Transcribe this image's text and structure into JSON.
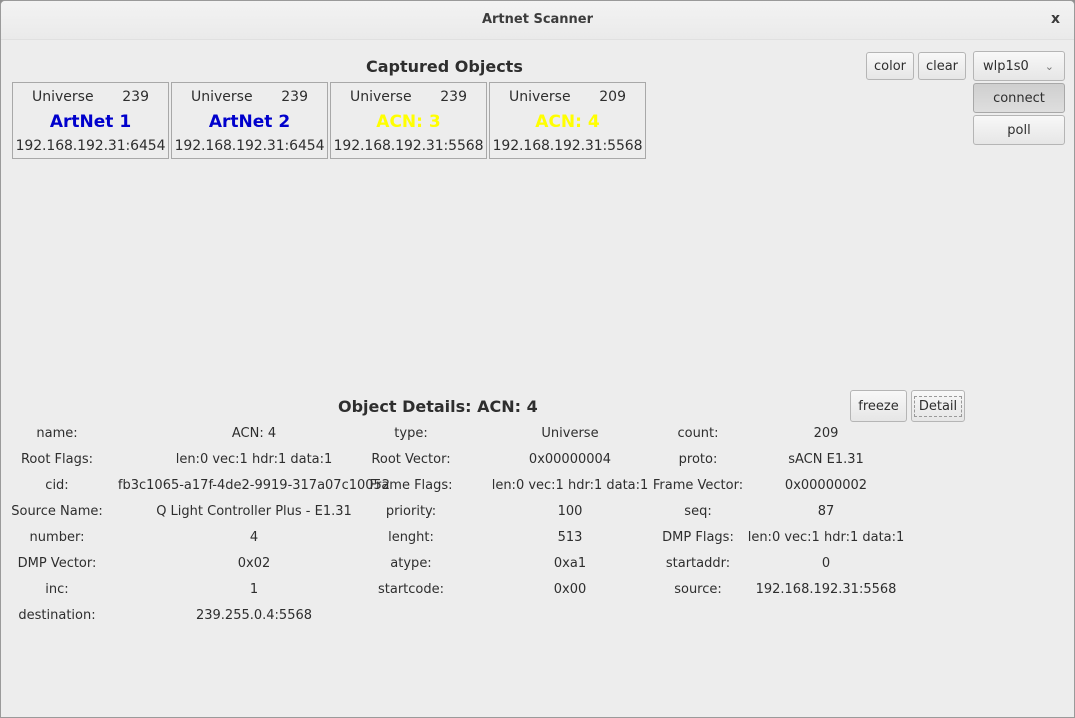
{
  "window": {
    "title": "Artnet Scanner",
    "close_glyph": "x"
  },
  "captured": {
    "title": "Captured Objects",
    "cards": [
      {
        "type": "Universe",
        "count": "239",
        "name": "ArtNet 1",
        "address": "192.168.192.31:6454",
        "name_color": "#0000cc"
      },
      {
        "type": "Universe",
        "count": "239",
        "name": "ArtNet 2",
        "address": "192.168.192.31:6454",
        "name_color": "#0000cc"
      },
      {
        "type": "Universe",
        "count": "239",
        "name": "ACN: 3",
        "address": "192.168.192.31:5568",
        "name_color": "#ffff00"
      },
      {
        "type": "Universe",
        "count": "209",
        "name": "ACN: 4",
        "address": "192.168.192.31:5568",
        "name_color": "#ffff00"
      }
    ]
  },
  "toolbar": {
    "color_label": "color",
    "clear_label": "clear",
    "interface_selected": "wlp1s0",
    "connect_label": "connect",
    "poll_label": "poll"
  },
  "details": {
    "title": "Object Details: ACN: 4",
    "freeze_label": "freeze",
    "detail_label": "Detail",
    "rows": [
      [
        [
          "name:",
          "ACN: 4"
        ],
        [
          "type:",
          "Universe"
        ],
        [
          "count:",
          "209"
        ]
      ],
      [
        [
          "Root Flags:",
          "len:0 vec:1 hdr:1 data:1"
        ],
        [
          "Root Vector:",
          "0x00000004"
        ],
        [
          "proto:",
          "sACN E1.31"
        ]
      ],
      [
        [
          "cid:",
          "fb3c1065-a17f-4de2-9919-317a07c10052"
        ],
        [
          "Frame Flags:",
          "len:0 vec:1 hdr:1 data:1"
        ],
        [
          "Frame Vector:",
          "0x00000002"
        ]
      ],
      [
        [
          "Source Name:",
          "Q Light Controller Plus - E1.31"
        ],
        [
          "priority:",
          "100"
        ],
        [
          "seq:",
          "87"
        ]
      ],
      [
        [
          "number:",
          "4"
        ],
        [
          "lenght:",
          "513"
        ],
        [
          "DMP Flags:",
          "len:0 vec:1 hdr:1 data:1"
        ]
      ],
      [
        [
          "DMP Vector:",
          "0x02"
        ],
        [
          "atype:",
          "0xa1"
        ],
        [
          "startaddr:",
          "0"
        ]
      ],
      [
        [
          "inc:",
          "1"
        ],
        [
          "startcode:",
          "0x00"
        ],
        [
          "source:",
          "192.168.192.31:5568"
        ]
      ],
      [
        [
          "destination:",
          "239.255.0.4:5568"
        ]
      ]
    ]
  }
}
